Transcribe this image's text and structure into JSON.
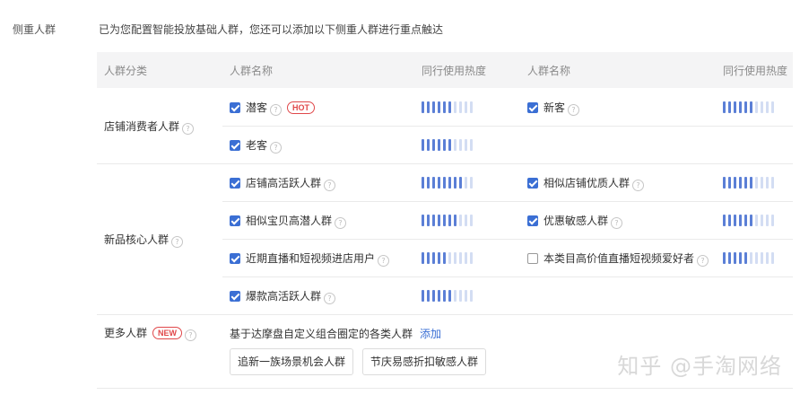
{
  "section": {
    "label": "侧重人群",
    "intro": "已为您配置智能投放基础人群，您还可以添加以下侧重人群进行重点触达"
  },
  "table": {
    "headers": [
      "人群分类",
      "人群名称",
      "同行使用热度",
      "人群名称",
      "同行使用热度"
    ]
  },
  "heat_colors": {
    "on": "#5b7fd6",
    "off": "#d3ddf3"
  },
  "groups": [
    {
      "category": "店铺消费者人群",
      "rows": [
        {
          "left": {
            "name": "潜客",
            "checked": true,
            "badge": "HOT",
            "heat": 6
          },
          "right": {
            "name": "新客",
            "checked": true,
            "heat": 6
          }
        },
        {
          "left": {
            "name": "老客",
            "checked": true,
            "heat": 6
          }
        }
      ]
    },
    {
      "category": "新品核心人群",
      "rows": [
        {
          "left": {
            "name": "店铺高活跃人群",
            "checked": true,
            "heat": 8
          },
          "right": {
            "name": "相似店铺优质人群",
            "checked": true,
            "heat": 6
          }
        },
        {
          "left": {
            "name": "相似宝贝高潜人群",
            "checked": true,
            "heat": 7
          },
          "right": {
            "name": "优惠敏感人群",
            "checked": true,
            "heat": 6
          }
        },
        {
          "left": {
            "name": "近期直播和短视频进店用户",
            "checked": true,
            "heat": 5
          },
          "right": {
            "name": "本类目高价值直播短视频爱好者",
            "checked": false,
            "heat": 5
          }
        },
        {
          "left": {
            "name": "爆款高活跃人群",
            "checked": true,
            "heat": 6
          }
        }
      ]
    }
  ],
  "more": {
    "category": "更多人群",
    "badge": "NEW",
    "description": "基于达摩盘自定义组合圈定的各类人群",
    "add_link": "添加",
    "tags": [
      "追新一族场景机会人群",
      "节庆易感折扣敏感人群"
    ]
  },
  "watermark": "知乎 @手淘网络"
}
